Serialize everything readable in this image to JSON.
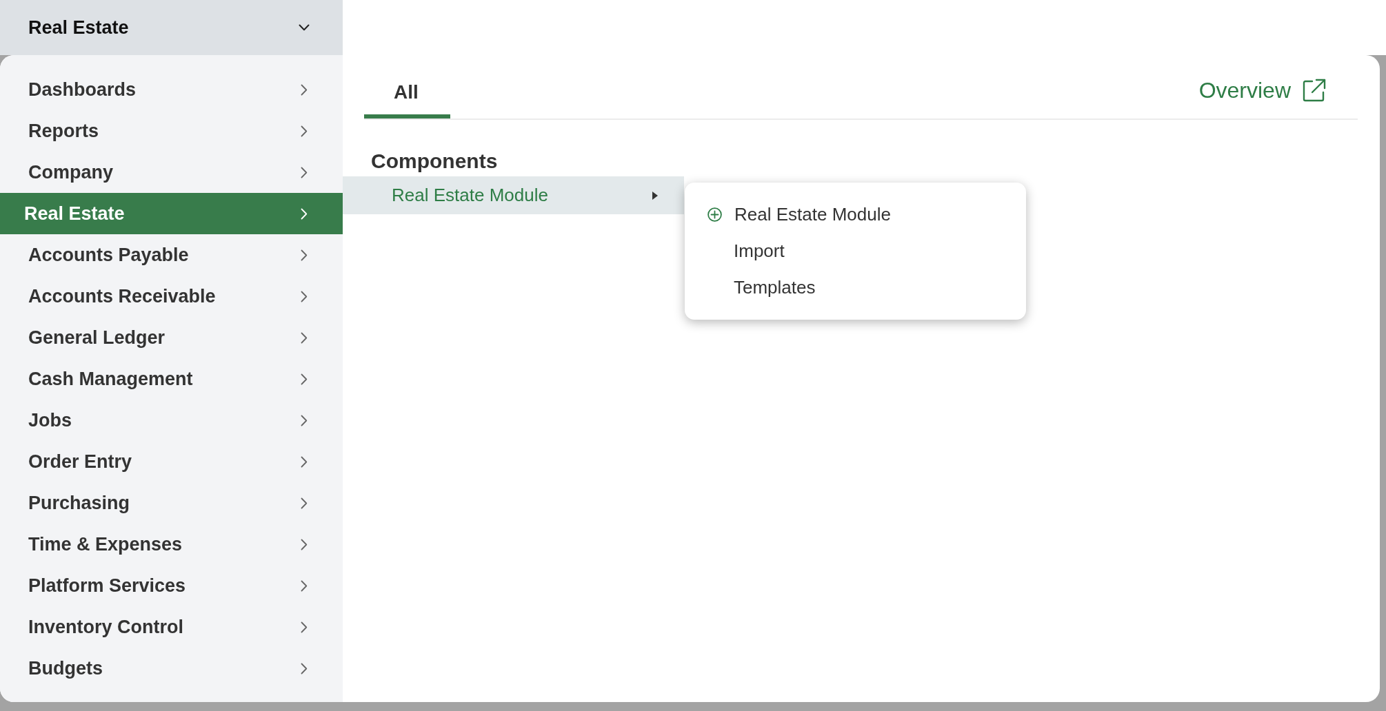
{
  "header": {
    "module_selector": "Real Estate"
  },
  "sidebar": {
    "items": [
      {
        "label": "Dashboards",
        "selected": false
      },
      {
        "label": "Reports",
        "selected": false
      },
      {
        "label": "Company",
        "selected": false
      },
      {
        "label": "Real Estate",
        "selected": true
      },
      {
        "label": "Accounts Payable",
        "selected": false
      },
      {
        "label": "Accounts Receivable",
        "selected": false
      },
      {
        "label": "General Ledger",
        "selected": false
      },
      {
        "label": "Cash Management",
        "selected": false
      },
      {
        "label": "Jobs",
        "selected": false
      },
      {
        "label": "Order Entry",
        "selected": false
      },
      {
        "label": "Purchasing",
        "selected": false
      },
      {
        "label": "Time & Expenses",
        "selected": false
      },
      {
        "label": "Platform Services",
        "selected": false
      },
      {
        "label": "Inventory Control",
        "selected": false
      },
      {
        "label": "Budgets",
        "selected": false
      }
    ]
  },
  "tabs": [
    {
      "label": "All",
      "selected": true
    }
  ],
  "overview_link": "Overview",
  "sections": [
    {
      "title": "Components",
      "items": [
        {
          "label": "Real Estate Module",
          "expanded": true,
          "submenu": [
            {
              "kind": "add",
              "label": "Real Estate Module"
            },
            {
              "kind": "plain",
              "label": "Import"
            },
            {
              "kind": "plain",
              "label": "Templates"
            }
          ]
        }
      ]
    }
  ]
}
